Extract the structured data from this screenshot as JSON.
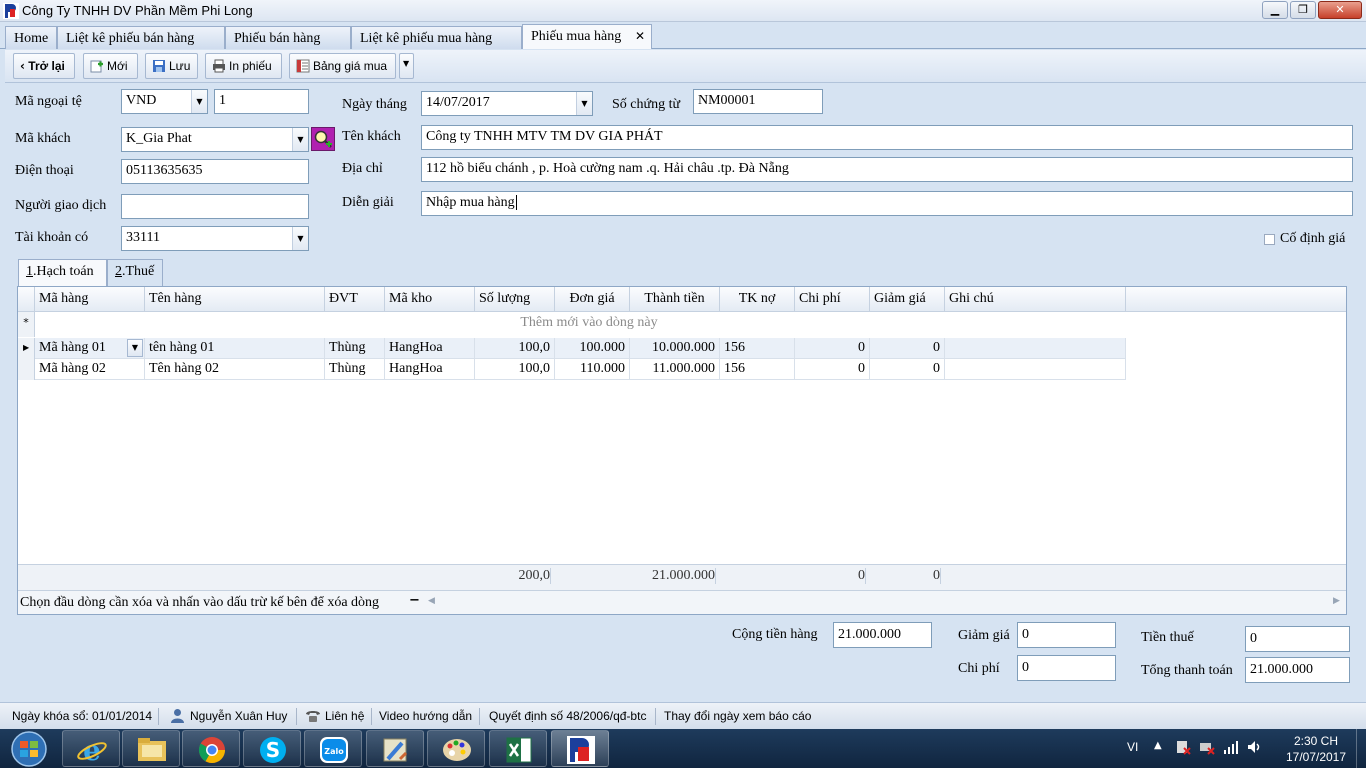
{
  "window": {
    "title": "Công Ty TNHH DV Phần Mềm Phi Long"
  },
  "tabs": [
    {
      "label": "Home"
    },
    {
      "label": "Liệt kê phiếu bán hàng"
    },
    {
      "label": "Phiếu bán hàng"
    },
    {
      "label": "Liệt kê phiếu mua hàng"
    },
    {
      "label": "Phiếu mua hàng",
      "active": true
    }
  ],
  "toolbar": {
    "back": "Trở lại",
    "new": "Mới",
    "save": "Lưu",
    "print": "In phiếu",
    "price_list": "Bảng giá mua"
  },
  "form": {
    "currency_label": "Mã ngoại tệ",
    "currency_value": "VND",
    "rate_value": "1",
    "date_label": "Ngày tháng",
    "date_value": "14/07/2017",
    "voucher_label": "Số chứng từ",
    "voucher_value": "NM00001",
    "customer_code_label": "Mã khách",
    "customer_code_value": "K_Gia Phat",
    "customer_name_label": "Tên khách",
    "customer_name_value": "Công ty TNHH MTV TM DV GIA PHÁT",
    "phone_label": "Điện thoại",
    "phone_value": "05113635635",
    "address_label": "Địa chỉ",
    "address_value": "112 hồ biểu chánh , p. Hoà cường nam .q. Hải châu .tp. Đà Nẵng",
    "contact_label": "Người giao dịch",
    "contact_value": "",
    "description_label": "Diễn giải",
    "description_value": "Nhập mua hàng",
    "credit_account_label": "Tài khoản có",
    "credit_account_value": "33111",
    "fixed_price_label": "Cố định giá"
  },
  "subtabs": [
    {
      "underline": "1",
      "rest": ".Hạch toán",
      "active": true
    },
    {
      "underline": "2",
      "rest": ".Thuế",
      "active": false
    }
  ],
  "grid": {
    "columns": [
      "Mã hàng",
      "Tên hàng",
      "ĐVT",
      "Mã kho",
      "Số lượng",
      "Đơn giá",
      "Thành tiền",
      "TK nợ",
      "Chi phí",
      "Giảm giá",
      "Ghi chú"
    ],
    "new_row_marker": "*",
    "new_row_text": "Thêm mới vào dòng này",
    "rows": [
      [
        "Mã hàng 01",
        "tên hàng 01",
        "Thùng",
        "HangHoa",
        "100,0",
        "100.000",
        "10.000.000",
        "156",
        "0",
        "0",
        ""
      ],
      [
        "Mã hàng 02",
        "Tên hàng 02",
        "Thùng",
        "HangHoa",
        "100,0",
        "110.000",
        "11.000.000",
        "156",
        "0",
        "0",
        ""
      ]
    ],
    "footer": {
      "quantity": "200,0",
      "amount": "21.000.000",
      "cost": "0",
      "discount": "0"
    },
    "hint": "Chọn đầu dòng cần xóa và nhấn vào dấu trừ kế bên để xóa dòng"
  },
  "totals": {
    "goods_label": "Cộng tiền hàng",
    "goods_value": "21.000.000",
    "discount_label": "Giảm giá",
    "discount_value": "0",
    "cost_label": "Chi phí",
    "cost_value": "0",
    "tax_label": "Tiền thuế",
    "tax_value": "0",
    "total_label": "Tổng thanh toán",
    "total_value": "21.000.000"
  },
  "status": {
    "lock_date": "Ngày khóa sổ: 01/01/2014",
    "user": "Nguyễn Xuân Huy",
    "contact": "Liên hệ",
    "video": "Video hướng dẫn",
    "decision": "Quyết định số 48/2006/qđ-btc",
    "change_date": "Thay đổi ngày xem báo cáo"
  },
  "taskbar": {
    "lang": "VI",
    "time": "2:30 CH",
    "date": "17/07/2017",
    "apps": [
      "internet-explorer",
      "file-explorer",
      "chrome",
      "skype",
      "zalo",
      "tool",
      "paint",
      "excel",
      "phi-long"
    ]
  }
}
